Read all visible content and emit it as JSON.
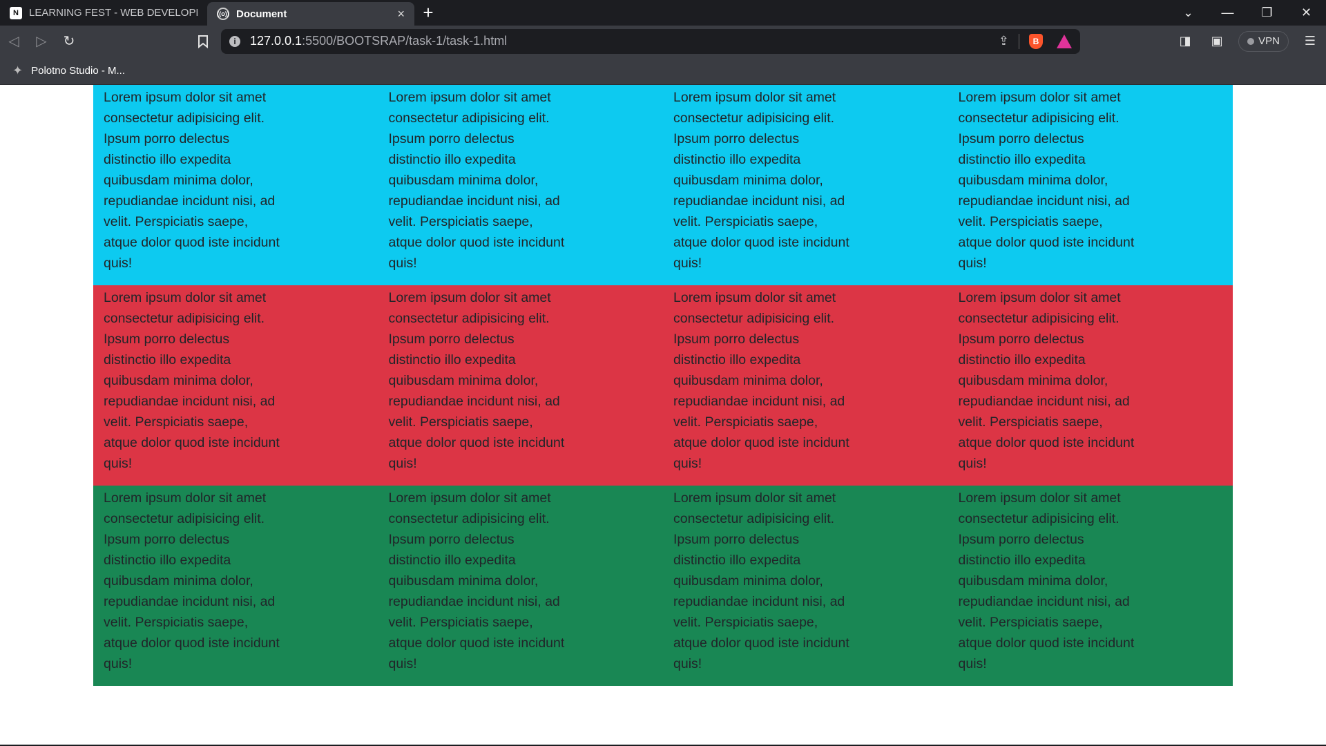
{
  "browser": {
    "tabs": [
      {
        "title": "LEARNING FEST - WEB DEVELOPMENT",
        "favicon": "N",
        "active": false
      },
      {
        "title": "Document",
        "favicon": "((o))",
        "active": true,
        "close": "×"
      }
    ],
    "new_tab": "+",
    "window_controls": {
      "tab_list": "⌄",
      "minimize": "—",
      "restore": "❐",
      "close": "✕"
    },
    "nav": {
      "back": "◁",
      "forward": "▷",
      "reload": "↻",
      "bookmark": "🔖"
    },
    "url": {
      "host": "127.0.0.1",
      "path": ":5500/BOOTSRAP/task-1/task-1.html"
    },
    "toolbar_icons": {
      "share": "⇪",
      "sidebar": "◨",
      "wallet": "▣",
      "menu": "☰"
    },
    "vpn_label": "VPN",
    "bookmarks": [
      {
        "label": "Polotno Studio - M..."
      }
    ]
  },
  "page": {
    "rows": [
      {
        "color": "#0dcaf0",
        "cells": [
          "Lorem ipsum dolor sit amet consectetur adipisicing elit. Ipsum porro delectus distinctio illo expedita quibusdam minima dolor, repudiandae incidunt nisi, ad velit. Perspiciatis saepe, atque dolor quod iste incidunt quis!",
          "Lorem ipsum dolor sit amet consectetur adipisicing elit. Ipsum porro delectus distinctio illo expedita quibusdam minima dolor, repudiandae incidunt nisi, ad velit. Perspiciatis saepe, atque dolor quod iste incidunt quis!",
          "Lorem ipsum dolor sit amet consectetur adipisicing elit. Ipsum porro delectus distinctio illo expedita quibusdam minima dolor, repudiandae incidunt nisi, ad velit. Perspiciatis saepe, atque dolor quod iste incidunt quis!",
          "Lorem ipsum dolor sit amet consectetur adipisicing elit. Ipsum porro delectus distinctio illo expedita quibusdam minima dolor, repudiandae incidunt nisi, ad velit. Perspiciatis saepe, atque dolor quod iste incidunt quis!"
        ]
      },
      {
        "color": "#dc3545",
        "cells": [
          "Lorem ipsum dolor sit amet consectetur adipisicing elit. Ipsum porro delectus distinctio illo expedita quibusdam minima dolor, repudiandae incidunt nisi, ad velit. Perspiciatis saepe, atque dolor quod iste incidunt quis!",
          "Lorem ipsum dolor sit amet consectetur adipisicing elit. Ipsum porro delectus distinctio illo expedita quibusdam minima dolor, repudiandae incidunt nisi, ad velit. Perspiciatis saepe, atque dolor quod iste incidunt quis!",
          "Lorem ipsum dolor sit amet consectetur adipisicing elit. Ipsum porro delectus distinctio illo expedita quibusdam minima dolor, repudiandae incidunt nisi, ad velit. Perspiciatis saepe, atque dolor quod iste incidunt quis!",
          "Lorem ipsum dolor sit amet consectetur adipisicing elit. Ipsum porro delectus distinctio illo expedita quibusdam minima dolor, repudiandae incidunt nisi, ad velit. Perspiciatis saepe, atque dolor quod iste incidunt quis!"
        ]
      },
      {
        "color": "#198754",
        "cells": [
          "Lorem ipsum dolor sit amet consectetur adipisicing elit. Ipsum porro delectus distinctio illo expedita quibusdam minima dolor, repudiandae incidunt nisi, ad velit. Perspiciatis saepe, atque dolor quod iste incidunt quis!",
          "Lorem ipsum dolor sit amet consectetur adipisicing elit. Ipsum porro delectus distinctio illo expedita quibusdam minima dolor, repudiandae incidunt nisi, ad velit. Perspiciatis saepe, atque dolor quod iste incidunt quis!",
          "Lorem ipsum dolor sit amet consectetur adipisicing elit. Ipsum porro delectus distinctio illo expedita quibusdam minima dolor, repudiandae incidunt nisi, ad velit. Perspiciatis saepe, atque dolor quod iste incidunt quis!",
          "Lorem ipsum dolor sit amet consectetur adipisicing elit. Ipsum porro delectus distinctio illo expedita quibusdam minima dolor, repudiandae incidunt nisi, ad velit. Perspiciatis saepe, atque dolor quod iste incidunt quis!"
        ]
      }
    ]
  }
}
